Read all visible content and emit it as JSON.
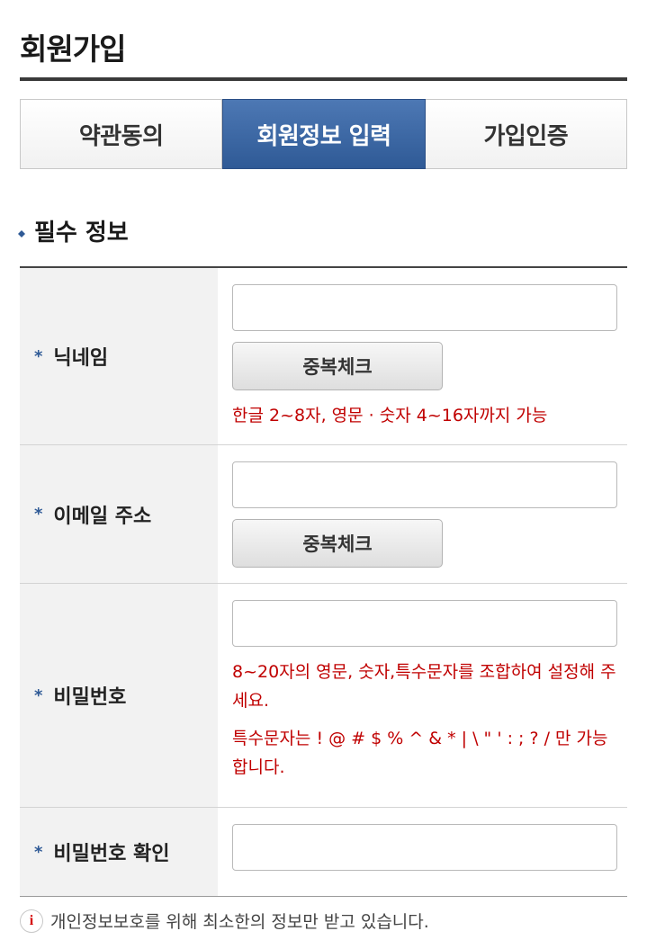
{
  "page": {
    "title": "회원가입"
  },
  "tabs": [
    {
      "label": "약관동의",
      "active": false
    },
    {
      "label": "회원정보 입력",
      "active": true
    },
    {
      "label": "가입인증",
      "active": false
    }
  ],
  "section": {
    "title": "필수 정보"
  },
  "fields": {
    "nickname": {
      "label": "닉네임",
      "button": "중복체크",
      "hint": "한글 2~8자, 영문 · 숫자 4~16자까지 가능"
    },
    "email": {
      "label": "이메일 주소",
      "button": "중복체크"
    },
    "password": {
      "label": "비밀번호",
      "hint1": "8~20자의 영문, 숫자,특수문자를 조합하여 설정해 주세요.",
      "hint2": "특수문자는 ! @ # $ % ^ & * | \\ \" ' : ; ? / 만 가능합니다."
    },
    "password_confirm": {
      "label": "비밀번호 확인"
    }
  },
  "required_mark": "*",
  "notice": {
    "icon_text": "i",
    "text": "개인정보보호를 위해 최소한의 정보만 받고 있습니다."
  },
  "colors": {
    "accent": "#2f5a96",
    "error": "#c00000"
  }
}
